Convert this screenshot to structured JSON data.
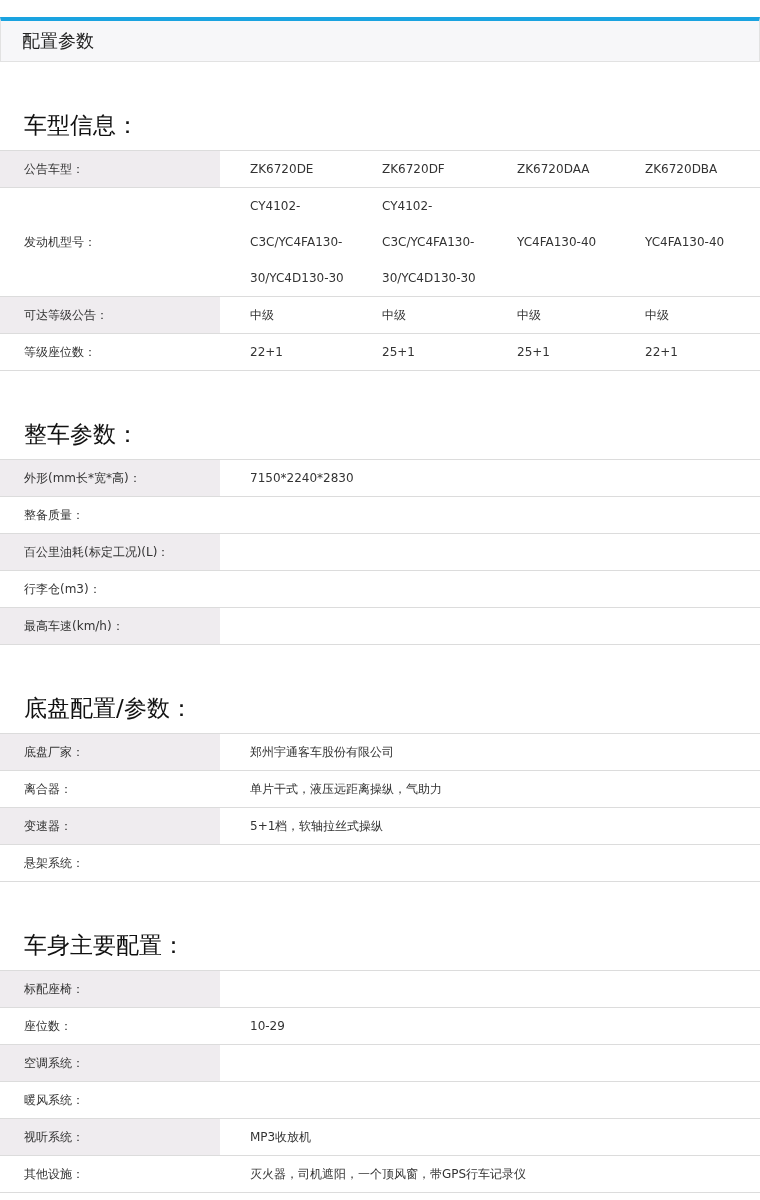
{
  "header": {
    "title": "配置参数"
  },
  "sections": [
    {
      "title": "车型信息：",
      "rows": [
        {
          "label": "公告车型：",
          "values": [
            "ZK6720DE",
            "ZK6720DF",
            "ZK6720DAA",
            "ZK6720DBA"
          ]
        },
        {
          "label": "发动机型号：",
          "values": [
            "CY4102-C3C/YC4FA130-30/YC4D130-30",
            "CY4102-C3C/YC4FA130-30/YC4D130-30",
            "YC4FA130-40",
            "YC4FA130-40"
          ]
        },
        {
          "label": "可达等级公告：",
          "values": [
            "中级",
            "中级",
            "中级",
            "中级"
          ]
        },
        {
          "label": "等级座位数：",
          "values": [
            "22+1",
            "25+1",
            "25+1",
            "22+1"
          ]
        }
      ]
    },
    {
      "title": "整车参数：",
      "rows": [
        {
          "label": "外形(mm长*宽*高)：",
          "values": [
            "7150*2240*2830"
          ]
        },
        {
          "label": "整备质量："
        },
        {
          "label": "百公里油耗(标定工况)(L)："
        },
        {
          "label": "行李仓(m3)："
        },
        {
          "label": "最高车速(km/h)："
        }
      ]
    },
    {
      "title": "底盘配置/参数：",
      "rows": [
        {
          "label": "底盘厂家：",
          "values": [
            "郑州宇通客车股份有限公司"
          ]
        },
        {
          "label": "离合器：",
          "values": [
            "单片干式，液压远距离操纵，气助力"
          ]
        },
        {
          "label": "变速器：",
          "values": [
            "5+1档，软轴拉丝式操纵"
          ]
        },
        {
          "label": "悬架系统："
        }
      ]
    },
    {
      "title": "车身主要配置：",
      "rows": [
        {
          "label": "标配座椅："
        },
        {
          "label": "座位数：",
          "values": [
            "10-29"
          ]
        },
        {
          "label": "空调系统："
        },
        {
          "label": "暖风系统："
        },
        {
          "label": "视听系统：",
          "values": [
            "MP3收放机"
          ]
        },
        {
          "label": "其他设施：",
          "values": [
            "灭火器，司机遮阳，一个顶风窗，带GPS行车记录仪"
          ]
        }
      ]
    }
  ]
}
